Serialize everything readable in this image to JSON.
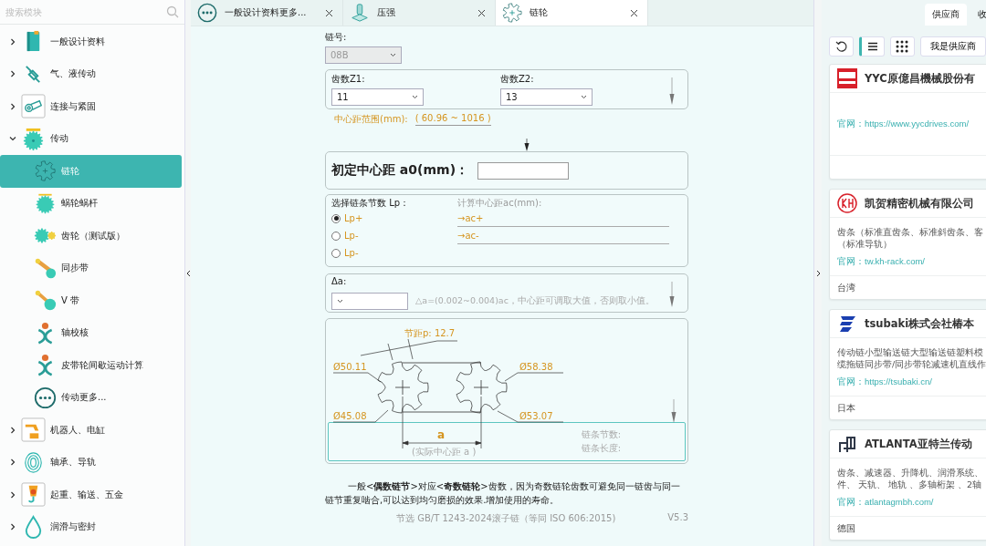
{
  "sidebar": {
    "search": {
      "placeholder": "搜索模块"
    },
    "items": [
      {
        "label": "一般设计资料",
        "expanded": false,
        "selected": false
      },
      {
        "label": "气、液传动",
        "expanded": false,
        "selected": false
      },
      {
        "label": "连接与紧固",
        "expanded": false,
        "selected": false
      },
      {
        "label": "传动",
        "expanded": true,
        "selected": false,
        "children": [
          {
            "label": "链轮",
            "selected": true
          },
          {
            "label": "蜗轮蜗杆",
            "selected": false
          },
          {
            "label": "齿轮（测试版）",
            "selected": false
          },
          {
            "label": "同步带",
            "selected": false
          },
          {
            "label": "V 带",
            "selected": false
          },
          {
            "label": "轴校核",
            "selected": false
          },
          {
            "label": "皮带轮间歇运动计算",
            "selected": false
          },
          {
            "label": "传动更多...",
            "selected": false
          }
        ]
      },
      {
        "label": "机器人、电缸",
        "expanded": false,
        "selected": false
      },
      {
        "label": "轴承、导轨",
        "expanded": false,
        "selected": false
      },
      {
        "label": "起重、输送、五金",
        "expanded": false,
        "selected": false
      },
      {
        "label": "润滑与密封",
        "expanded": false,
        "selected": false
      }
    ]
  },
  "tabs": [
    {
      "label": "一般设计资料更多...",
      "selected": false
    },
    {
      "label": "压强",
      "selected": false
    },
    {
      "label": "链轮",
      "selected": true
    }
  ],
  "form": {
    "chain_no": {
      "label": "链号:",
      "value": "08B"
    },
    "teeth": [
      {
        "label": "齿数Z1:",
        "value": "11"
      },
      {
        "label": "齿数Z2:",
        "value": "13"
      }
    ],
    "range": {
      "label": "中心距范围(mm):",
      "value": "( 60.96 ~ 1016 )"
    },
    "initial_distance": {
      "label": "初定中心距 a0(mm)："
    },
    "lp": {
      "label": "选择链条节数 Lp：",
      "result_label": "计算中心距ac(mm):",
      "options": [
        {
          "label": "Lp+",
          "result": "→ac+",
          "selected": true
        },
        {
          "label": "Lp-",
          "result": "→ac-",
          "selected": false
        },
        {
          "label": "Lp-",
          "selected": false
        }
      ]
    },
    "delta": {
      "label": "Δa:",
      "hint": "△a=(0.002~0.004)ac，中心距可调取大值，否则取小值。"
    },
    "diagram": {
      "pitch": "节距p:  12.7",
      "d1": "Ø50.11",
      "d2": "Ø58.38",
      "d3": "Ø45.08",
      "d4": "Ø53.07",
      "a": "a",
      "a_caption": "(实际中心距 a )",
      "chain_links": "链条节数:",
      "chain_length": "链条长度:"
    },
    "note": "一般<**偶数链节**>对应<**奇数链轮**>齿数，因为奇数链轮齿数可避免同一链齿与同一链节重复啮合,可以达到均匀磨损的效果.增加使用的寿命。",
    "source": "节选 GB/T 1243-2024滚子链（等同 ISO 606:2015)",
    "version": "V5.3"
  },
  "right_panel": {
    "tabs": [
      {
        "label": "供应商",
        "selected": true
      },
      {
        "label": "收",
        "selected": false
      }
    ],
    "views": [
      {
        "kind": "list",
        "selected": true
      },
      {
        "kind": "grid",
        "selected": false
      }
    ],
    "supplier_button": "我是供应商",
    "suppliers": [
      {
        "kind": "yyc",
        "name": "YYC原億昌機械股份有",
        "link_label": "官网：",
        "link": "https://www.yycdrives.com/"
      },
      {
        "kind": "kh",
        "name": "凯贺精密机械有限公司",
        "desc": [
          "齿条（标准直齿条、标准斜齿条、客",
          "（标准导轨）"
        ],
        "link_label": "官网：",
        "link": "tw.kh-rack.com/",
        "region": "台湾"
      },
      {
        "kind": "tsubaki",
        "name": "tsubaki株式会社椿本",
        "desc": [
          "传动链小型输送链大型输送链塑料模",
          "缆拖链同步带/同步带轮减速机直线作"
        ],
        "link_label": "官网：",
        "link": "https://tsubaki.cn/",
        "region": "日本"
      },
      {
        "kind": "atlanta",
        "name": "ATLANTA亚特兰传动",
        "desc": [
          "齿条、减速器、升降机、润滑系统、",
          "件、 天轨、 地轨 、多轴桁架 、2轴"
        ],
        "link_label": "官网：",
        "link": "atlantagmbh.com/",
        "region": "德国"
      }
    ]
  }
}
